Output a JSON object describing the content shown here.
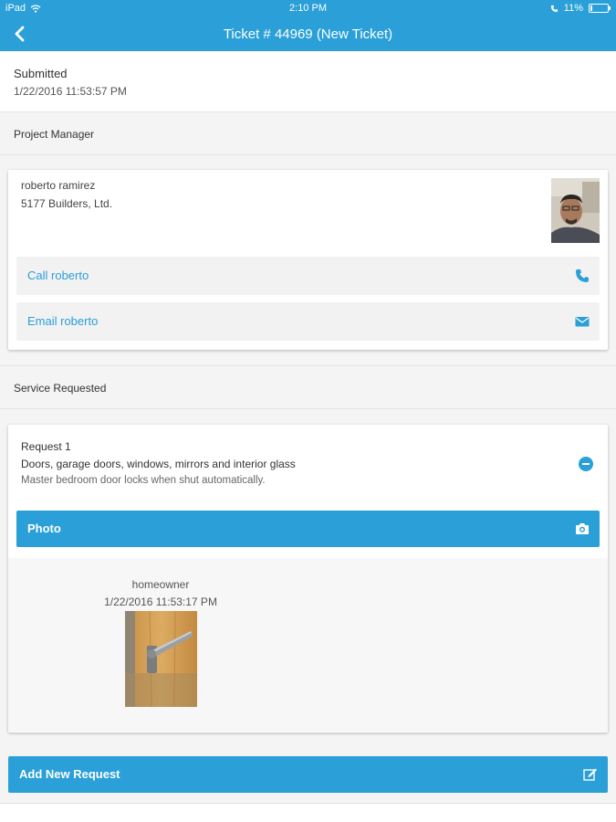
{
  "status_bar": {
    "device": "iPad",
    "time": "2:10 PM",
    "battery_text": "11%",
    "battery_level": 0.11
  },
  "nav": {
    "title": "Ticket # 44969 (New Ticket)",
    "back_icon": "chevron-left-icon"
  },
  "submitted": {
    "label": "Submitted",
    "value": "1/22/2016 11:53:57 PM"
  },
  "project_manager": {
    "header": "Project Manager",
    "name": "roberto ramirez",
    "company": "5177 Builders, Ltd.",
    "call_label": "Call roberto",
    "email_label": "Email roberto",
    "call_icon": "phone-icon",
    "email_icon": "envelope-icon"
  },
  "service": {
    "header": "Service Requested",
    "request_title": "Request 1",
    "category": "Doors, garage doors, windows, mirrors and interior glass",
    "description": "Master bedroom door locks when shut automatically.",
    "photo_label": "Photo",
    "photo_icon": "camera-icon",
    "photo_owner": "homeowner",
    "photo_date": "1/22/2016 11:53:17 PM"
  },
  "add_request": {
    "label": "Add New Request",
    "icon": "edit-icon"
  },
  "colors": {
    "accent": "#2a9fd8",
    "section_bg": "#f4f4f4"
  }
}
